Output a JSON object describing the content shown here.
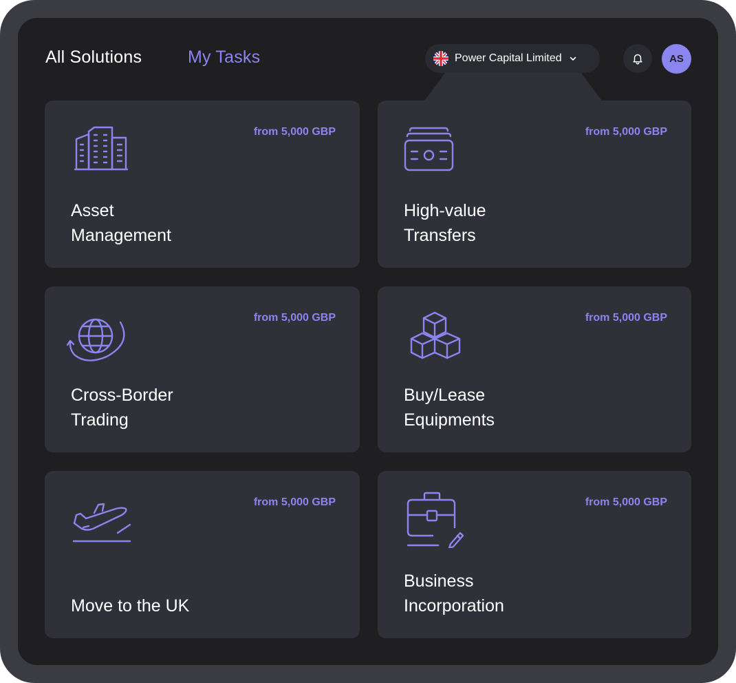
{
  "header": {
    "tabs": [
      {
        "label": "All Solutions",
        "active": false
      },
      {
        "label": "My Tasks",
        "active": true
      }
    ],
    "company": {
      "name": "Power Capital Limited",
      "flag": "uk-flag-icon"
    },
    "notifications_icon": "bell-icon",
    "avatar_initials": "AS"
  },
  "colors": {
    "accent": "#8c85f0",
    "background": "#1f1f22",
    "card": "#2f3038",
    "frame": "#3b3c42",
    "text": "#ffffff"
  },
  "solutions": [
    {
      "title_line1": "Asset",
      "title_line2": "Management",
      "price": "from 5,000 GBP",
      "icon": "buildings-icon"
    },
    {
      "title_line1": "High-value",
      "title_line2": "Transfers",
      "price": "from 5,000 GBP",
      "icon": "banknotes-icon"
    },
    {
      "title_line1": "Cross-Border",
      "title_line2": "Trading",
      "price": "from 5,000 GBP",
      "icon": "globe-orbit-icon"
    },
    {
      "title_line1": "Buy/Lease",
      "title_line2": "Equipments",
      "price": "from 5,000 GBP",
      "icon": "boxes-icon"
    },
    {
      "title_line1": "",
      "title_line2": "Move to the UK",
      "price": "from 5,000 GBP",
      "icon": "airplane-takeoff-icon"
    },
    {
      "title_line1": "Business",
      "title_line2": "Incorporation",
      "price": "from 5,000 GBP",
      "icon": "briefcase-pen-icon"
    }
  ]
}
